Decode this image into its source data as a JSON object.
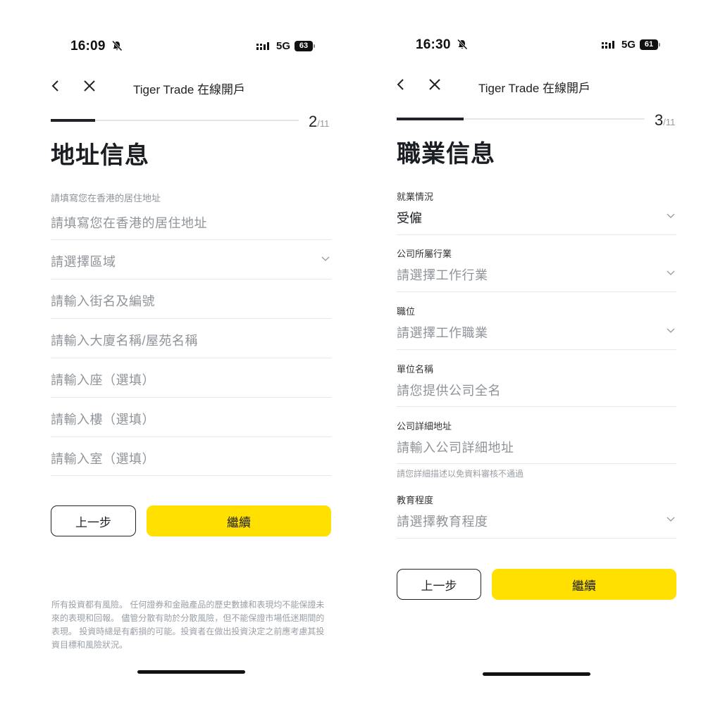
{
  "left": {
    "status": {
      "time": "16:09",
      "network": "5G",
      "battery": "63"
    },
    "nav": {
      "title": "Tiger Trade 在線開戶"
    },
    "progress": {
      "current": "2",
      "total": "/11",
      "fraction": 0.18
    },
    "page_title": "地址信息",
    "fields": {
      "address_label": "請填寫您在香港的居住地址",
      "address_placeholder": "請填寫您在香港的居住地址",
      "district_placeholder": "請選擇區域",
      "street_placeholder": "請輸入街名及編號",
      "building_placeholder": "請輸入大廈名稱/屋苑名稱",
      "block_placeholder": "請輸入座（選填）",
      "floor_placeholder": "請輸入樓（選填）",
      "room_placeholder": "請輸入室（選填）"
    },
    "buttons": {
      "prev": "上一步",
      "next": "繼續"
    },
    "disclaimer": "所有投資都有風險。 任何證券和金融產品的歷史數據和表現均不能保證未來的表現和回報。 儘管分散有助於分散風險，但不能保證市場低迷期間的表現。 投資時總是有虧損的可能。投資者在做出投資決定之前應考慮其投資目標和風險狀況。"
  },
  "right": {
    "status": {
      "time": "16:30",
      "network": "5G",
      "battery": "61"
    },
    "nav": {
      "title": "Tiger Trade 在線開戶"
    },
    "progress": {
      "current": "3",
      "total": "/11",
      "fraction": 0.27
    },
    "page_title": "職業信息",
    "fields": {
      "employment_label": "就業情況",
      "employment_value": "受僱",
      "industry_label": "公司所屬行業",
      "industry_placeholder": "請選擇工作行業",
      "position_label": "職位",
      "position_placeholder": "請選擇工作職業",
      "company_label": "單位名稱",
      "company_placeholder": "請您提供公司全名",
      "company_address_label": "公司詳細地址",
      "company_address_placeholder": "請輸入公司詳細地址",
      "company_address_hint": "請您詳細描述以免資料審核不通過",
      "education_label": "教育程度",
      "education_placeholder": "請選擇教育程度"
    },
    "buttons": {
      "prev": "上一步",
      "next": "繼續"
    }
  }
}
